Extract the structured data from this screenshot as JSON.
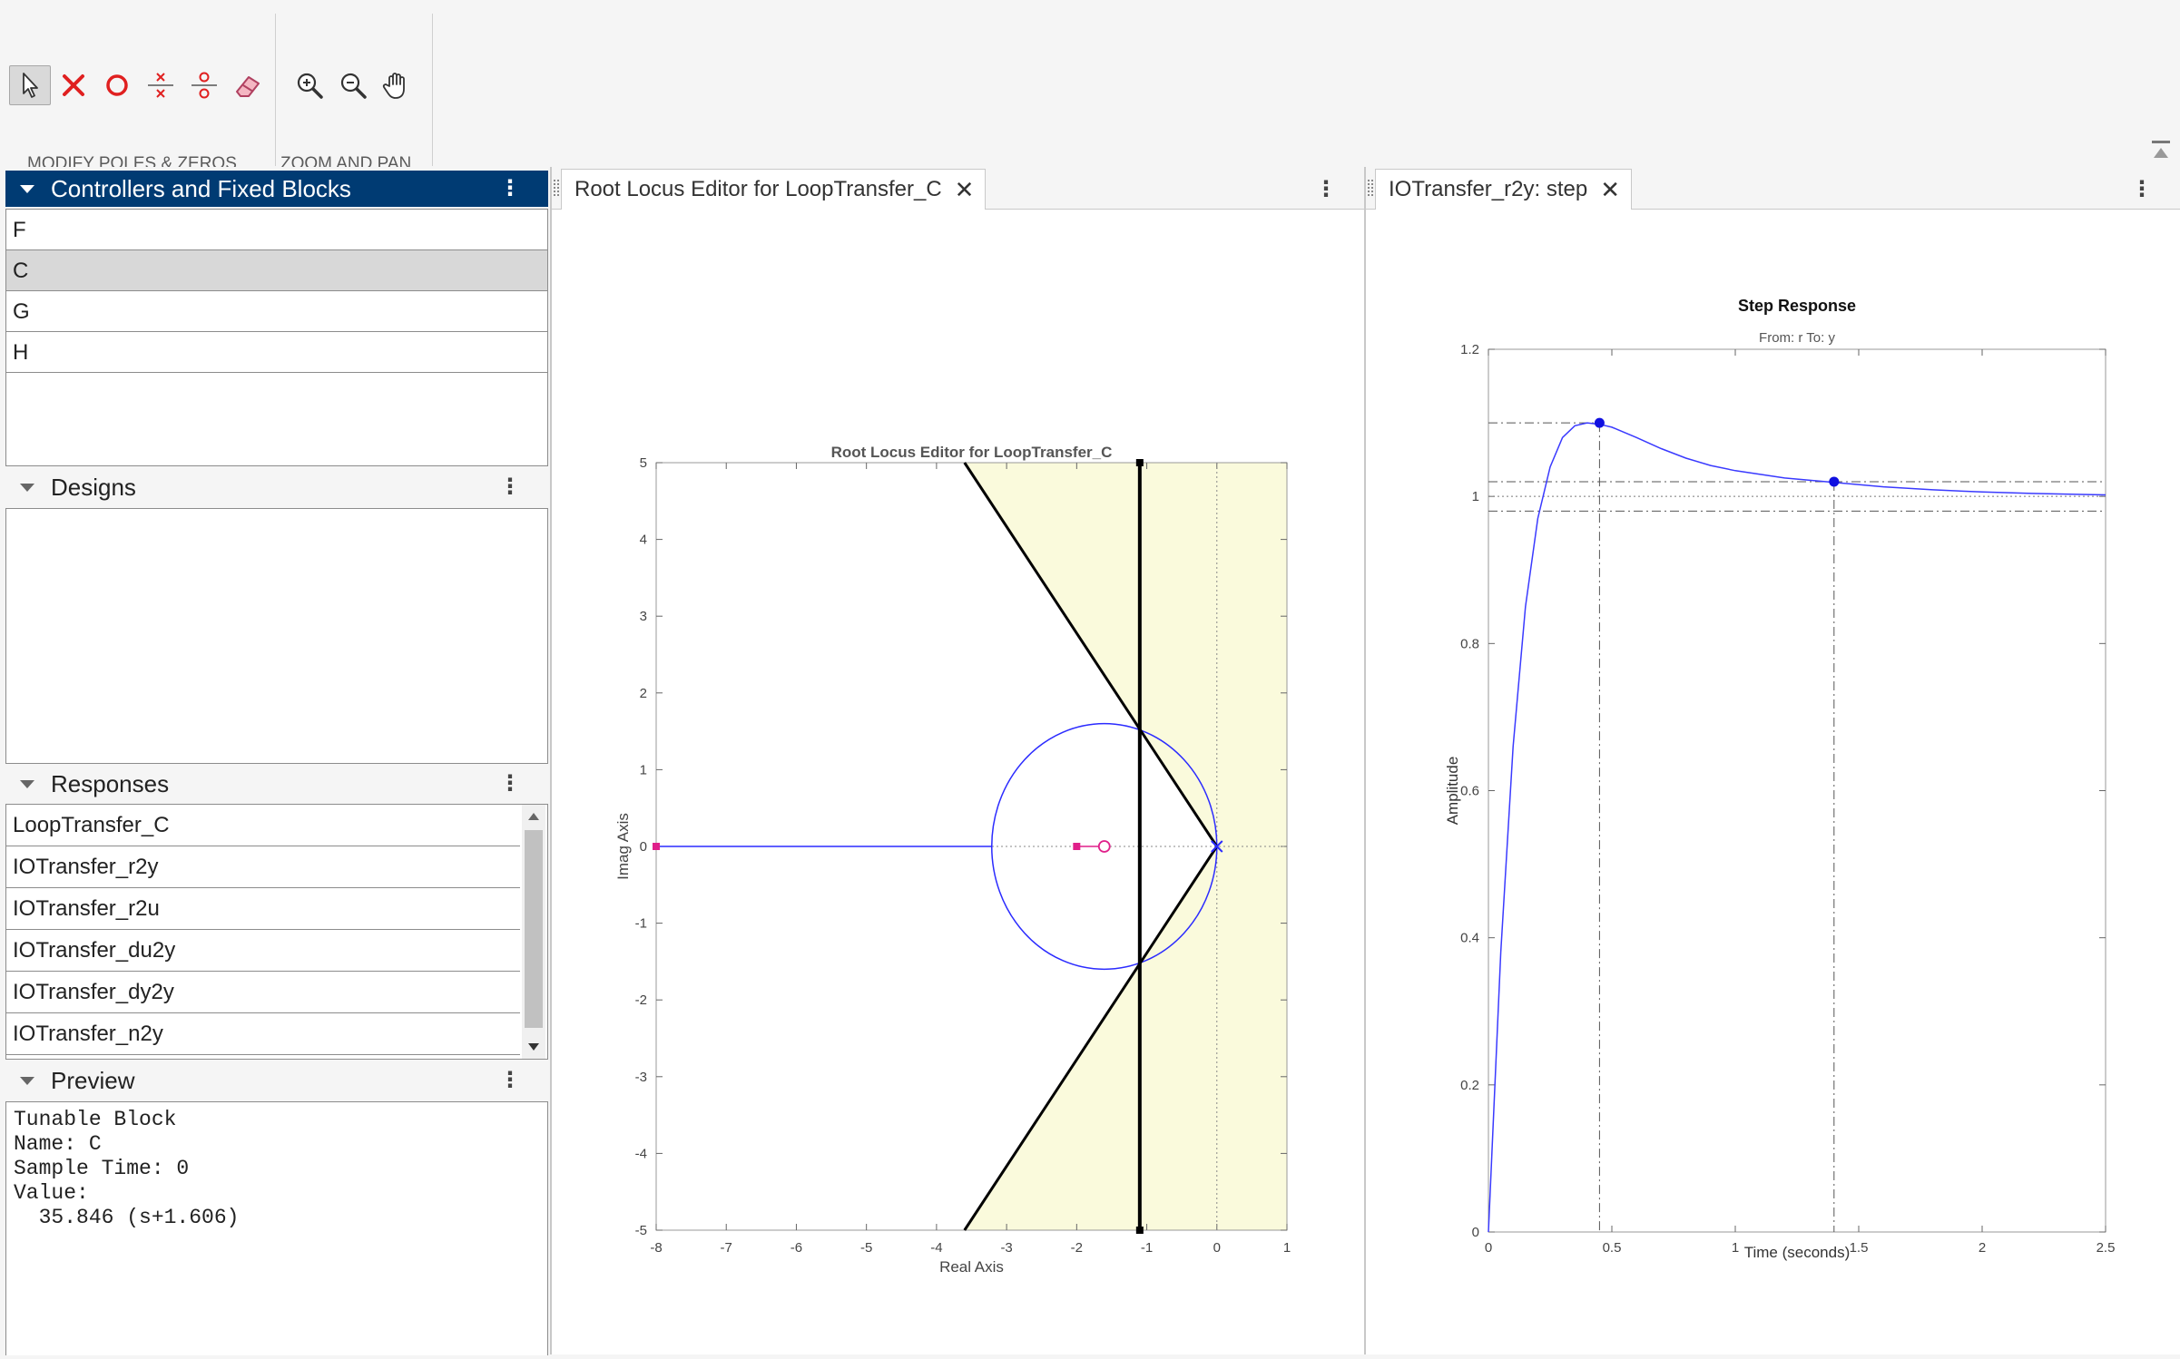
{
  "toolbar": {
    "modify_label": "MODIFY POLES & ZEROS",
    "zoom_label": "ZOOM AND PAN",
    "buttons": [
      "select-arrow",
      "add-pole",
      "add-zero",
      "add-complex-pole",
      "add-complex-zero",
      "erase"
    ],
    "zoom_buttons": [
      "zoom-in",
      "zoom-out",
      "pan"
    ]
  },
  "sidebar": {
    "controllers": {
      "title": "Controllers and Fixed Blocks",
      "items": [
        "F",
        "C",
        "G",
        "H"
      ],
      "selected": "C"
    },
    "designs": {
      "title": "Designs"
    },
    "responses": {
      "title": "Responses",
      "items": [
        "LoopTransfer_C",
        "IOTransfer_r2y",
        "IOTransfer_r2u",
        "IOTransfer_du2y",
        "IOTransfer_dy2y",
        "IOTransfer_n2y"
      ]
    },
    "preview": {
      "title": "Preview",
      "text": "Tunable Block\nName: C\nSample Time: 0\nValue:\n  35.846 (s+1.606)"
    }
  },
  "root_locus": {
    "tab_label": "Root Locus Editor for LoopTransfer_C",
    "colors": {
      "shade": "#fafadc",
      "locus": "#2b2bff",
      "pz": "#e0208a",
      "boundary": "#000000"
    }
  },
  "step": {
    "tab_label": "IOTransfer_r2y: step",
    "subtitle": "From: r  To: y"
  },
  "chart_data": [
    {
      "type": "line",
      "title": "Root Locus Editor for LoopTransfer_C",
      "xlabel": "Real Axis",
      "ylabel": "Imag Axis",
      "xlim": [
        -8,
        1
      ],
      "ylim": [
        -5,
        5
      ],
      "xticks": [
        -8,
        -7,
        -6,
        -5,
        -4,
        -3,
        -2,
        -1,
        0,
        1
      ],
      "yticks": [
        -5,
        -4,
        -3,
        -2,
        -1,
        0,
        1,
        2,
        3,
        4,
        5
      ],
      "poles": [
        {
          "x": 0,
          "y": 0
        }
      ],
      "zeros": [
        {
          "x": -1.606,
          "y": 0
        }
      ],
      "closed_loop_poles": [
        {
          "x": -2.0,
          "y": 0
        },
        {
          "x": -1.1,
          "y": 5
        },
        {
          "x": -1.1,
          "y": -5
        }
      ],
      "locus_circle": {
        "center_x": -1.606,
        "center_y": 0,
        "radius_x": 1.606,
        "radius_y": 1.6
      },
      "locus_real_segment": [
        -8,
        -3.2
      ],
      "design_region": {
        "real_limit": -1.1,
        "damping_line_points": [
          [
            -3.6,
            5
          ],
          [
            0,
            0
          ],
          [
            -3.6,
            -5
          ]
        ]
      }
    },
    {
      "type": "line",
      "title": "Step Response",
      "xlabel": "Time (seconds)",
      "ylabel": "Amplitude",
      "xlim": [
        0,
        2.5
      ],
      "ylim": [
        0,
        1.2
      ],
      "xticks": [
        0,
        0.5,
        1,
        1.5,
        2,
        2.5
      ],
      "yticks": [
        0,
        0.2,
        0.4,
        0.6,
        0.8,
        1,
        1.2
      ],
      "series": [
        {
          "x": [
            0,
            0.05,
            0.1,
            0.15,
            0.2,
            0.25,
            0.3,
            0.35,
            0.4,
            0.45,
            0.5,
            0.6,
            0.7,
            0.8,
            0.9,
            1.0,
            1.2,
            1.4,
            1.6,
            1.8,
            2.0,
            2.2,
            2.5
          ],
          "y": [
            0,
            0.38,
            0.66,
            0.85,
            0.97,
            1.04,
            1.08,
            1.096,
            1.1,
            1.098,
            1.094,
            1.08,
            1.065,
            1.052,
            1.042,
            1.035,
            1.025,
            1.019,
            1.013,
            1.009,
            1.006,
            1.004,
            1.002
          ]
        }
      ],
      "peak": {
        "x": 0.45,
        "y": 1.1
      },
      "settling": {
        "x": 1.4,
        "y": 1.02
      },
      "steady_state": 1,
      "settling_band": [
        0.98,
        1.02
      ]
    }
  ]
}
